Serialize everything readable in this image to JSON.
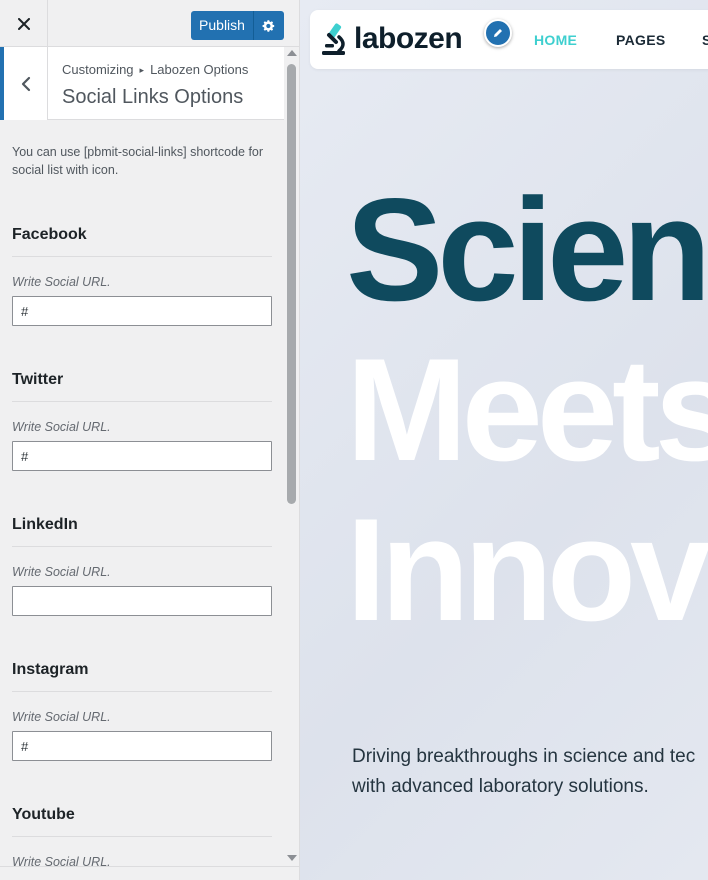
{
  "sidebar": {
    "close_icon": "close-icon",
    "publish_label": "Publish",
    "publish_settings_icon": "gear-icon",
    "breadcrumb": {
      "root": "Customizing",
      "parent": "Labozen Options"
    },
    "section_title": "Social Links Options",
    "description": "You can use [pbmit-social-links] shortcode for social list with icon.",
    "fields": [
      {
        "label": "Facebook",
        "hint": "Write Social URL.",
        "value": "#"
      },
      {
        "label": "Twitter",
        "hint": "Write Social URL.",
        "value": "#"
      },
      {
        "label": "LinkedIn",
        "hint": "Write Social URL.",
        "value": ""
      },
      {
        "label": "Instagram",
        "hint": "Write Social URL.",
        "value": "#"
      },
      {
        "label": "Youtube",
        "hint": "Write Social URL.",
        "value": ""
      }
    ]
  },
  "preview": {
    "logo_text": "labozen",
    "logo_icon": "microscope-icon",
    "nav": {
      "home": "HOME",
      "pages": "PAGES",
      "next": "S"
    },
    "hero_lines": [
      "Scien",
      "Meets",
      "Innov"
    ],
    "subtitle_lines": [
      "Driving breakthroughs in science and tec",
      "with advanced laboratory solutions."
    ]
  },
  "colors": {
    "accent_blue": "#2271b1",
    "hero_dark": "#0f4a5e",
    "nav_active": "#3ecfcf",
    "sidebar_bg": "#f0f0f1"
  }
}
